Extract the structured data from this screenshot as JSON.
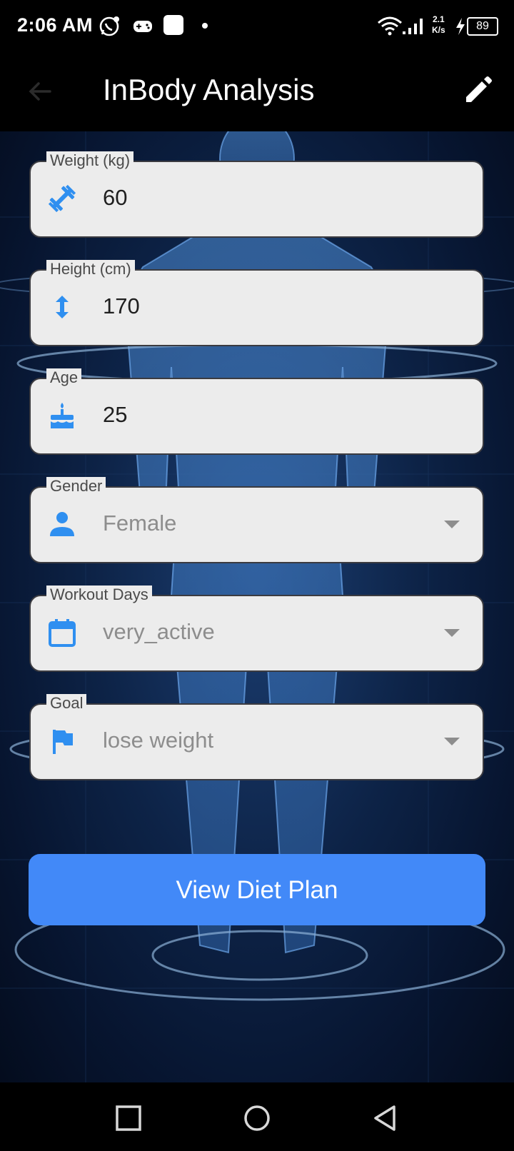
{
  "status": {
    "time": "2:06 AM",
    "net_speed_top": "2.1",
    "net_speed_bottom": "K/s",
    "battery": "89"
  },
  "appbar": {
    "title": "InBody Analysis"
  },
  "fields": {
    "weight": {
      "label": "Weight (kg)",
      "value": "60",
      "icon": "dumbbell-icon"
    },
    "height": {
      "label": "Height (cm)",
      "value": "170",
      "icon": "vertical-arrows-icon"
    },
    "age": {
      "label": "Age",
      "value": "25",
      "icon": "cake-icon"
    },
    "gender": {
      "label": "Gender",
      "value": "Female",
      "icon": "person-icon"
    },
    "workout": {
      "label": "Workout Days",
      "value": "very_active",
      "icon": "calendar-icon"
    },
    "goal": {
      "label": "Goal",
      "value": "lose weight",
      "icon": "flag-icon"
    }
  },
  "button": {
    "label": "View Diet Plan"
  },
  "colors": {
    "accent": "#4289f8",
    "icon": "#2f8ff0",
    "field_bg": "#ececec"
  }
}
